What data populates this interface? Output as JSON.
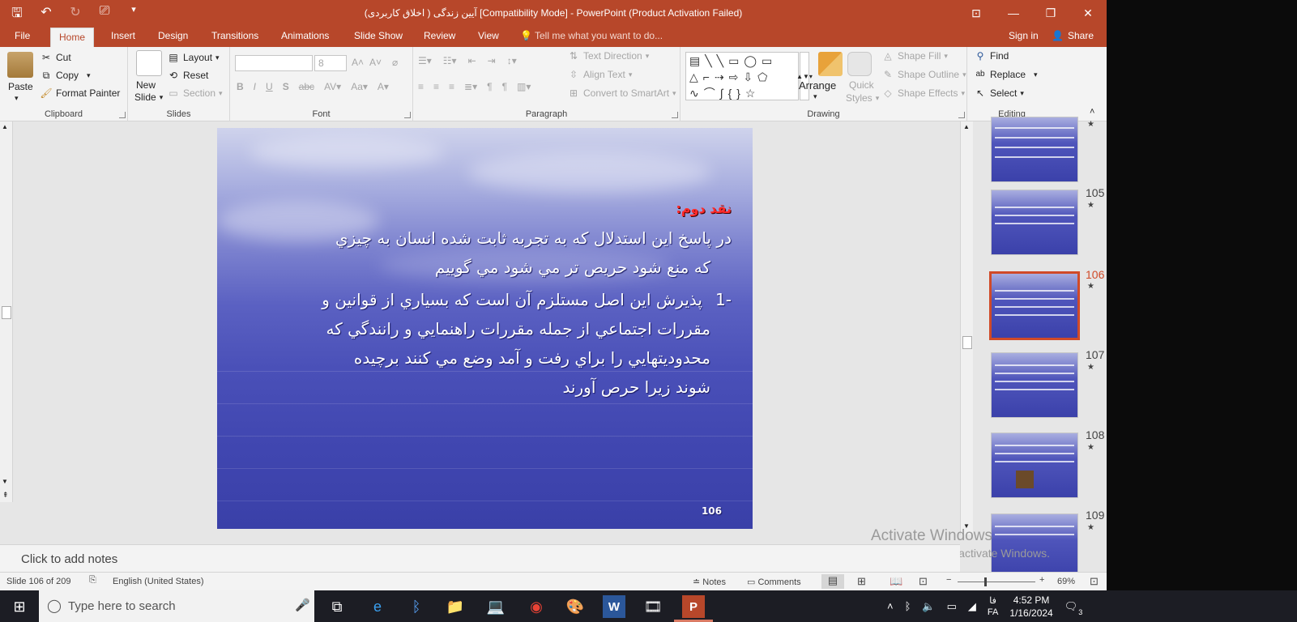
{
  "window": {
    "title": "آیین زندگی ( اخلاق کاربردی) [Compatibility Mode] - PowerPoint (Product Activation Failed)"
  },
  "tabs": [
    "File",
    "Home",
    "Insert",
    "Design",
    "Transitions",
    "Animations",
    "Slide Show",
    "Review",
    "View"
  ],
  "tell_me": "Tell me what you want to do...",
  "account": {
    "signin": "Sign in",
    "share": "Share"
  },
  "clipboard": {
    "paste": "Paste",
    "cut": "Cut",
    "copy": "Copy",
    "format_painter": "Format Painter",
    "label": "Clipboard"
  },
  "slides_group": {
    "new_slide_1": "New",
    "new_slide_2": "Slide",
    "layout": "Layout",
    "reset": "Reset",
    "section": "Section",
    "label": "Slides"
  },
  "font": {
    "size": "8",
    "label": "Font"
  },
  "paragraph": {
    "text_direction": "Text Direction",
    "align_text": "Align Text",
    "smartart": "Convert to SmartArt",
    "label": "Paragraph"
  },
  "drawing": {
    "arrange": "Arrange",
    "quick_styles_1": "Quick",
    "quick_styles_2": "Styles",
    "shape_fill": "Shape Fill",
    "shape_outline": "Shape Outline",
    "shape_effects": "Shape Effects",
    "label": "Drawing"
  },
  "editing": {
    "find": "Find",
    "replace": "Replace",
    "select": "Select",
    "label": "Editing"
  },
  "slide": {
    "heading": "نقد دوم:",
    "para1_line1": "در پاسخ اين استدلال كه به تجربه ثابت شده انسان به چيزي",
    "para1_line2": "كه منع شود حريص تر مي شود مي گوييم",
    "bullet_number": "1-",
    "para2_line1": "پذيرش اين اصل مستلزم آن است كه بسياري از قوانين و",
    "para2_line2": "مقررات اجتماعي از جمله مقررات راهنمايي و رانندگي كه",
    "para2_line3": "محدوديتهايي را براي رفت و آمد وضع مي كنند برچيده",
    "para2_line4": "شوند زيرا حرص آورند",
    "number": "106"
  },
  "thumbnails": [
    {
      "num": "",
      "star": "★"
    },
    {
      "num": "105",
      "star": "★"
    },
    {
      "num": "106",
      "star": "★"
    },
    {
      "num": "107",
      "star": "★"
    },
    {
      "num": "108",
      "star": "★"
    },
    {
      "num": "109",
      "star": "★"
    }
  ],
  "notes_placeholder": "Click to add notes",
  "activate": {
    "line1": "Activate Windows",
    "line2": "Go to Settings to activate Windows."
  },
  "status": {
    "slide_info": "Slide 106 of 209",
    "language": "English (United States)",
    "notes": "Notes",
    "comments": "Comments",
    "zoom": "69%"
  },
  "taskbar": {
    "search_placeholder": "Type here to search",
    "lang": "FA",
    "lang2": "فا",
    "time": "4:52 PM",
    "date": "1/16/2024",
    "notif_count": "3"
  },
  "colors": {
    "accent": "#b7472a",
    "selected_thumb": "#d04a28"
  }
}
